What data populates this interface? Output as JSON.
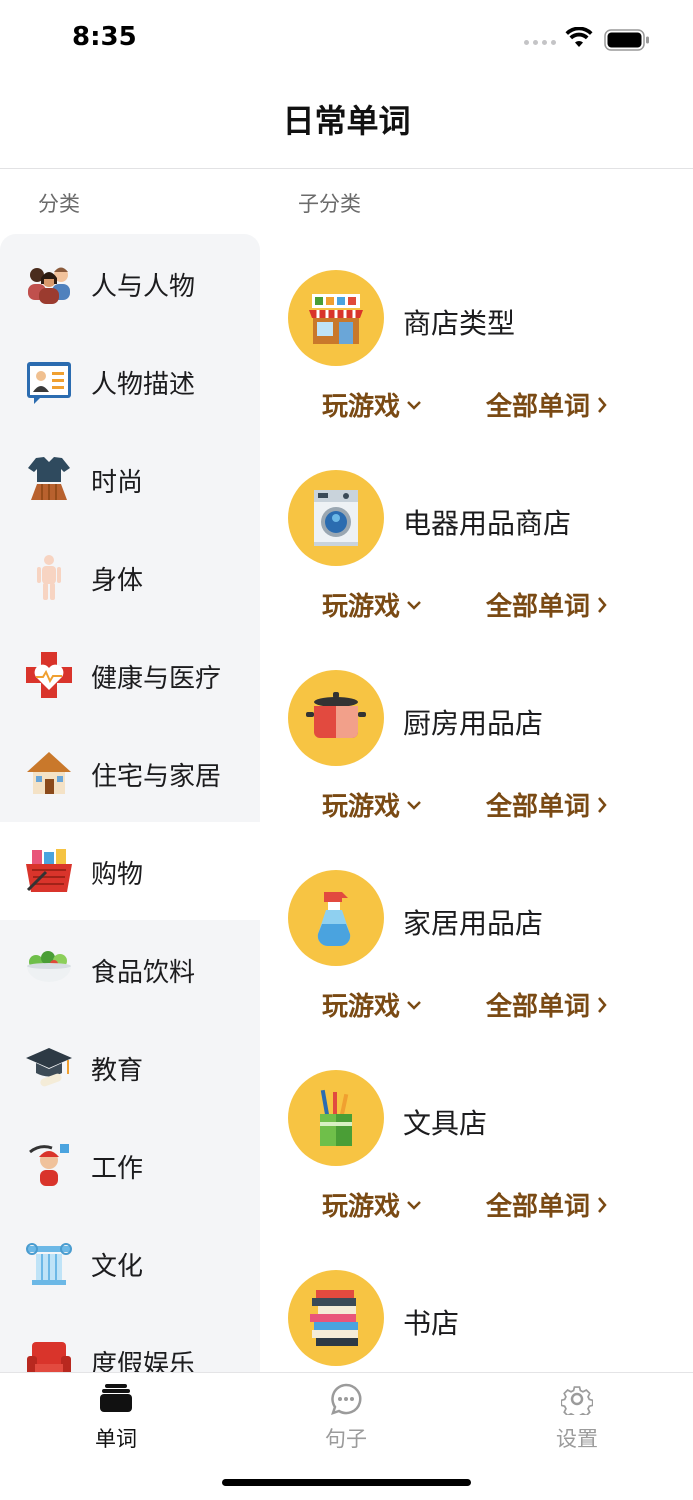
{
  "status_bar": {
    "time": "8:35"
  },
  "nav": {
    "title": "日常单词"
  },
  "headers": {
    "category": "分类",
    "subcategory": "子分类"
  },
  "sidebar": {
    "active_index": 6,
    "items": [
      {
        "label": "人与人物",
        "icon": "people-icon"
      },
      {
        "label": "人物描述",
        "icon": "profile-card-icon"
      },
      {
        "label": "时尚",
        "icon": "clothing-icon"
      },
      {
        "label": "身体",
        "icon": "body-icon"
      },
      {
        "label": "健康与医疗",
        "icon": "health-heart-icon"
      },
      {
        "label": "住宅与家居",
        "icon": "house-icon"
      },
      {
        "label": "购物",
        "icon": "shopping-basket-icon"
      },
      {
        "label": "食品饮料",
        "icon": "salad-bowl-icon"
      },
      {
        "label": "教育",
        "icon": "graduation-cap-icon"
      },
      {
        "label": "工作",
        "icon": "worker-icon"
      },
      {
        "label": "文化",
        "icon": "column-icon"
      },
      {
        "label": "度假娱乐",
        "icon": "armchair-icon"
      }
    ]
  },
  "subcategories": [
    {
      "title": "商店类型",
      "icon": "storefront-icon"
    },
    {
      "title": "电器用品商店",
      "icon": "washing-machine-icon"
    },
    {
      "title": "厨房用品店",
      "icon": "cooking-pot-icon"
    },
    {
      "title": "家居用品店",
      "icon": "spray-bottle-icon"
    },
    {
      "title": "文具店",
      "icon": "pencil-cup-icon"
    },
    {
      "title": "书店",
      "icon": "book-stack-icon"
    }
  ],
  "actions": {
    "play_label": "玩游戏",
    "all_words_label": "全部单词"
  },
  "tabs": [
    {
      "label": "单词",
      "icon": "cards-icon",
      "active": true
    },
    {
      "label": "句子",
      "icon": "chat-bubble-icon",
      "active": false
    },
    {
      "label": "设置",
      "icon": "gear-icon",
      "active": false
    }
  ],
  "colors": {
    "accent_brown": "#7a4a14",
    "circle_yellow": "#f7c443",
    "sidebar_bg": "#f4f5f7"
  }
}
